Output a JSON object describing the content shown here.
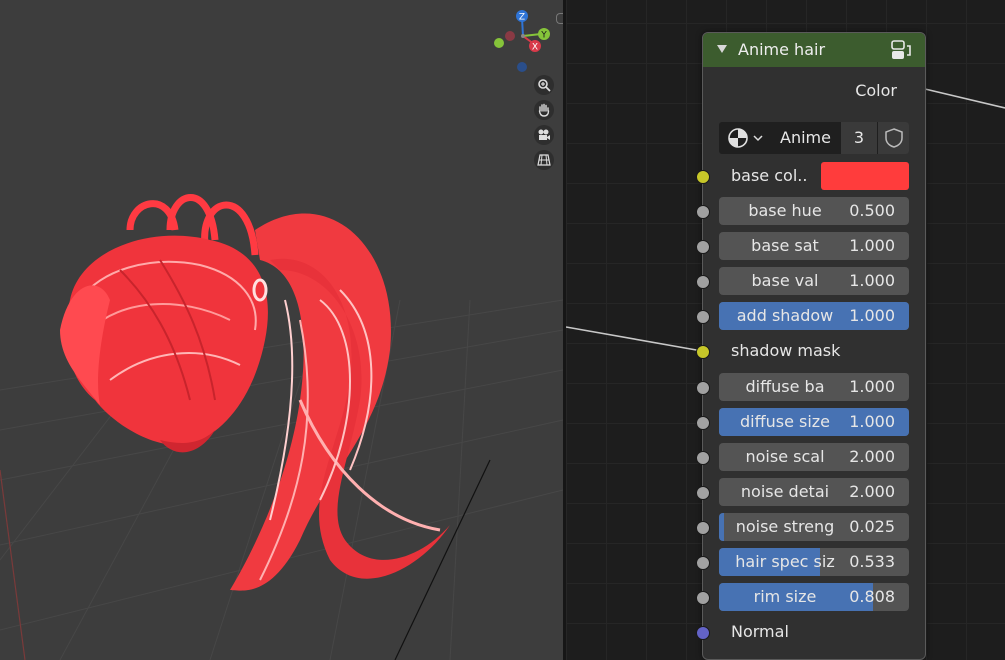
{
  "node": {
    "title": "Anime hair",
    "output_label": "Color",
    "material": {
      "name": "Anime",
      "users": "3"
    },
    "base_color": {
      "label": "base col..",
      "color": "#ff3c3c"
    },
    "inputs": [
      {
        "label": "base hue",
        "value": "0.500",
        "fill": 0.0,
        "socket": "value"
      },
      {
        "label": "base sat",
        "value": "1.000",
        "fill": 0.0,
        "socket": "value"
      },
      {
        "label": "base val",
        "value": "1.000",
        "fill": 0.0,
        "socket": "value"
      },
      {
        "label": "add shadow",
        "value": "1.000",
        "fill": 1.0,
        "socket": "value"
      },
      {
        "label": "shadow mask",
        "value": "",
        "fill": 0.0,
        "socket": "color",
        "plain": true
      },
      {
        "label": "diffuse ba",
        "value": "1.000",
        "fill": 0.0,
        "socket": "value"
      },
      {
        "label": "diffuse size",
        "value": "1.000",
        "fill": 1.0,
        "socket": "value"
      },
      {
        "label": "noise scal",
        "value": "2.000",
        "fill": 0.0,
        "socket": "value"
      },
      {
        "label": "noise detai",
        "value": "2.000",
        "fill": 0.0,
        "socket": "value"
      },
      {
        "label": "noise streng",
        "value": "0.025",
        "fill": 0.025,
        "socket": "value"
      },
      {
        "label": "hair spec siz",
        "value": "0.533",
        "fill": 0.533,
        "socket": "value"
      },
      {
        "label": "rim size",
        "value": "0.808",
        "fill": 0.808,
        "socket": "value"
      },
      {
        "label": "Normal",
        "value": "",
        "fill": 0.0,
        "socket": "vector",
        "plain": true
      }
    ]
  },
  "gizmo": {
    "x_label": "X",
    "y_label": "Y",
    "z_label": "Z"
  },
  "viewport_nav_icons": [
    "zoom-icon",
    "hand-pan-icon",
    "camera-icon",
    "grid-view-icon"
  ],
  "colors": {
    "header": "#3c5c2e",
    "slider_fill": "#4772b3",
    "color_socket": "#c7c729",
    "value_socket": "#a1a1a1",
    "vector_socket": "#6363c7"
  }
}
